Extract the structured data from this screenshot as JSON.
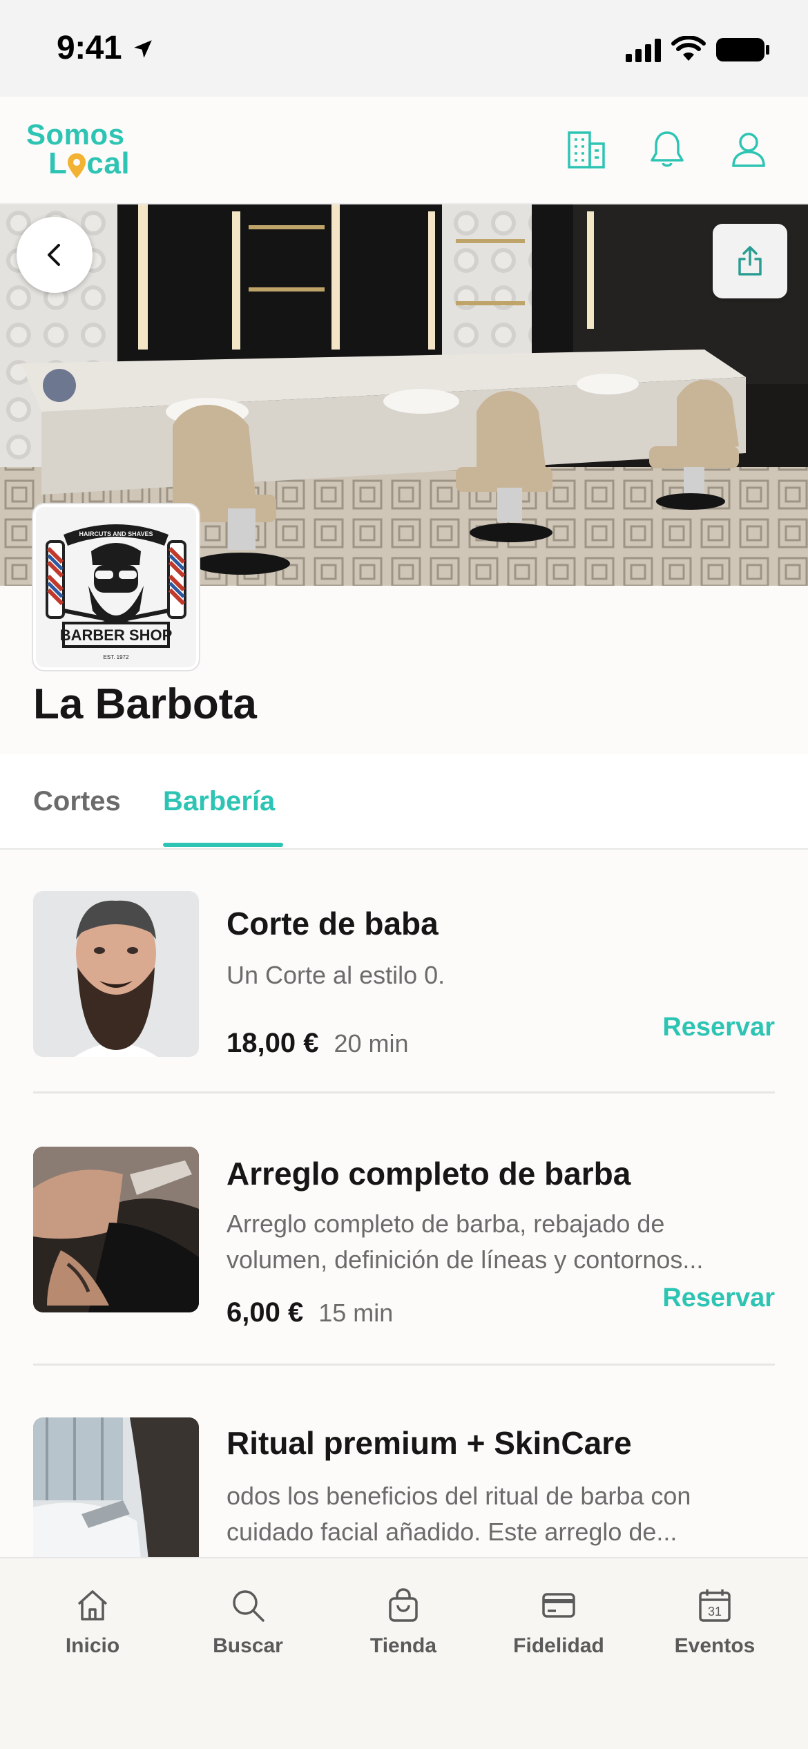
{
  "status_bar": {
    "time": "9:41"
  },
  "header": {
    "logo_line1": "Somos",
    "logo_line2_pre": "L",
    "logo_line2_post": "cal"
  },
  "shop": {
    "name": "La Barbota",
    "logo_text_top": "HAIRCUTS AND SHAVES",
    "logo_text_main": "BARBER SHOP",
    "logo_text_small": "EST. 1972"
  },
  "tabs": [
    {
      "label": "Cortes",
      "active": false
    },
    {
      "label": "Barbería",
      "active": true
    }
  ],
  "services": [
    {
      "title": "Corte de baba",
      "desc_line1": "Un Corte al estilo 0.",
      "desc_line2": "",
      "price": "18,00 €",
      "duration": "20 min",
      "action": "Reservar"
    },
    {
      "title": "Arreglo completo de barba",
      "desc_line1": "Arreglo completo de barba, rebajado de",
      "desc_line2": "volumen, definición de líneas y contornos...",
      "price": "6,00 €",
      "duration": "15 min",
      "action": "Reservar"
    },
    {
      "title": "Ritual premium + SkinCare",
      "desc_line1": "odos los beneficios del ritual de barba con",
      "desc_line2": "cuidado facial añadido. Este arreglo de...",
      "price": "",
      "duration": "",
      "action": ""
    }
  ],
  "tabbar": [
    {
      "label": "Inicio",
      "icon": "home-icon"
    },
    {
      "label": "Buscar",
      "icon": "search-icon"
    },
    {
      "label": "Tienda",
      "icon": "bag-icon"
    },
    {
      "label": "Fidelidad",
      "icon": "card-icon"
    },
    {
      "label": "Eventos",
      "icon": "calendar-icon"
    }
  ],
  "calendar_day": "31",
  "colors": {
    "accent": "#2ec4b4",
    "pin": "#f2b233",
    "text": "#161616",
    "muted": "#6b6b6b"
  }
}
